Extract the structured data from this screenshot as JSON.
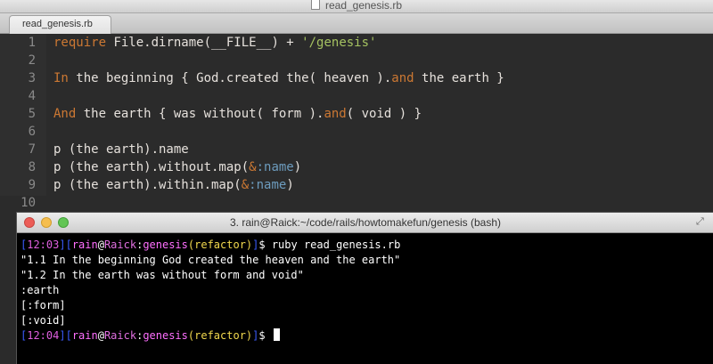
{
  "editor": {
    "window_title": "read_genesis.rb",
    "tab_label": "read_genesis.rb",
    "lines": [
      {
        "num": "1",
        "parts": [
          {
            "t": "require",
            "c": "kw"
          },
          {
            "t": " File.dirname(__FILE__) + ",
            "c": ""
          },
          {
            "t": "'/genesis'",
            "c": "str"
          }
        ]
      },
      {
        "num": "2",
        "parts": []
      },
      {
        "num": "3",
        "parts": [
          {
            "t": "In",
            "c": "kw"
          },
          {
            "t": " the beginning { God.created the( heaven ).",
            "c": ""
          },
          {
            "t": "and",
            "c": "kw"
          },
          {
            "t": " the earth }",
            "c": ""
          }
        ]
      },
      {
        "num": "4",
        "parts": []
      },
      {
        "num": "5",
        "parts": [
          {
            "t": "And",
            "c": "kw"
          },
          {
            "t": " the earth { was without( form ).",
            "c": ""
          },
          {
            "t": "and",
            "c": "kw"
          },
          {
            "t": "( void ) }",
            "c": ""
          }
        ]
      },
      {
        "num": "6",
        "parts": []
      },
      {
        "num": "7",
        "parts": [
          {
            "t": "p (the earth).name",
            "c": ""
          }
        ]
      },
      {
        "num": "8",
        "parts": [
          {
            "t": "p (the earth).without.map(",
            "c": ""
          },
          {
            "t": "&",
            "c": "kw"
          },
          {
            "t": ":name",
            "c": "sym"
          },
          {
            "t": ")",
            "c": ""
          }
        ]
      },
      {
        "num": "9",
        "parts": [
          {
            "t": "p (the earth).within.map(",
            "c": ""
          },
          {
            "t": "&",
            "c": "kw"
          },
          {
            "t": ":name",
            "c": "sym"
          },
          {
            "t": ")",
            "c": ""
          }
        ]
      },
      {
        "num": "10",
        "parts": []
      }
    ]
  },
  "terminal": {
    "title": "3. rain@Raick:~/code/rails/howtomakefun/genesis (bash)",
    "prompt1": {
      "time": "12:03",
      "user": "rain",
      "host": "Raick",
      "dir": "genesis",
      "branch": "refactor",
      "command": "ruby read_genesis.rb"
    },
    "output": [
      "\"1.1 In the beginning God created the heaven and the earth\"",
      "\"1.2 In the earth was without form and void\"",
      ":earth",
      "[:form]",
      "[:void]"
    ],
    "prompt2": {
      "time": "12:04",
      "user": "rain",
      "host": "Raick",
      "dir": "genesis",
      "branch": "refactor",
      "command": ""
    }
  }
}
